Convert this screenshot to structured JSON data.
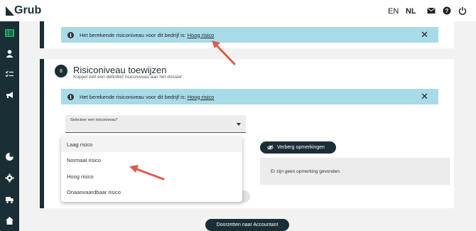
{
  "app": {
    "name": "Grub"
  },
  "header": {
    "languages": [
      "EN",
      "NL"
    ],
    "active_language": "NL",
    "icons": [
      "mail-icon",
      "help-icon",
      "power-icon"
    ]
  },
  "sidebar": {
    "icons": [
      "dashboard-icon",
      "user-icon",
      "checklist-icon",
      "megaphone-icon",
      "pie-chart-icon",
      "settings-icon",
      "truck-icon",
      "home-icon"
    ]
  },
  "top_card": {
    "alert_text": "Het berekende risiconiveau voor dit bedrijf is:",
    "alert_link": "Hoog risico"
  },
  "section": {
    "step": "8",
    "title": "Risiconiveau toewijzen",
    "subtitle": "Koppel zelf een definitief risiconiveau aan het dossier:",
    "alert_text": "Het berekende risiconiveau voor dit bedrijf is:",
    "alert_link": "Hoog risico",
    "select_label": "Selecteer een risiconiveau*",
    "options": [
      "Laag risico",
      "Normaal risico",
      "Hoog risico",
      "Onaanvaardbaar risico"
    ],
    "toggle_label": "Verberg opmerkingen",
    "remarks_text": "Er zijn geen opmerking gevonden."
  },
  "footer": {
    "continue_label": "Doorzetten naar Accountant"
  },
  "colors": {
    "primary": "#1a2e35",
    "info": "#a8dbe8",
    "annotation": "#e05a47"
  }
}
